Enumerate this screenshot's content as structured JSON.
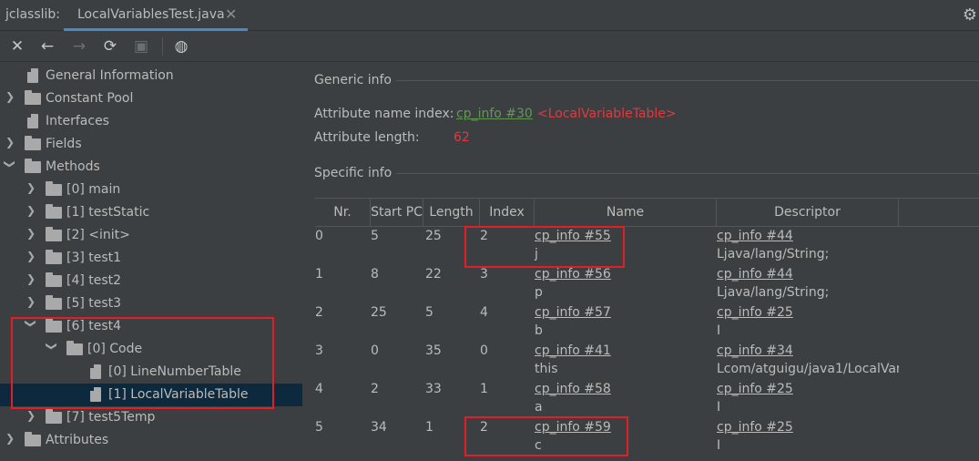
{
  "tabbar": {
    "prefix": "jclasslib:",
    "tab_title": "LocalVariablesTest.java",
    "close_glyph": "✕",
    "gear_glyph": "⚙"
  },
  "toolbar": {
    "close_icon": "✕",
    "back_icon": "←",
    "forward_icon": "→",
    "refresh_icon": "⟳",
    "save_icon": "▣",
    "browser_icon": "◍"
  },
  "tree": {
    "items": [
      {
        "label": "General Information"
      },
      {
        "label": "Constant Pool"
      },
      {
        "label": "Interfaces"
      },
      {
        "label": "Fields"
      },
      {
        "label": "Methods"
      },
      {
        "label": "[0] main"
      },
      {
        "label": "[1] testStatic"
      },
      {
        "label": "[2] <init>"
      },
      {
        "label": "[3] test1"
      },
      {
        "label": "[4] test2"
      },
      {
        "label": "[5] test3"
      },
      {
        "label": "[6] test4"
      },
      {
        "label": "[0] Code"
      },
      {
        "label": "[0] LineNumberTable"
      },
      {
        "label": "[1] LocalVariableTable"
      },
      {
        "label": "[7] test5Temp"
      },
      {
        "label": "Attributes"
      }
    ]
  },
  "generic": {
    "title": "Generic info",
    "name_index_label": "Attribute name index:",
    "name_index_link": "cp_info #30",
    "name_index_value": "<LocalVariableTable>",
    "length_label": "Attribute length:",
    "length_value": "62"
  },
  "specific": {
    "title": "Specific info"
  },
  "table": {
    "headers": [
      "Nr.",
      "Start PC",
      "Length",
      "Index",
      "Name",
      "Descriptor"
    ],
    "rows": [
      {
        "nr": "0",
        "start": "5",
        "length": "25",
        "index": "2",
        "name_link": "cp_info #55",
        "name": "j",
        "desc_link": "cp_info #44",
        "desc": "Ljava/lang/String;"
      },
      {
        "nr": "1",
        "start": "8",
        "length": "22",
        "index": "3",
        "name_link": "cp_info #56",
        "name": "p",
        "desc_link": "cp_info #44",
        "desc": "Ljava/lang/String;"
      },
      {
        "nr": "2",
        "start": "25",
        "length": "5",
        "index": "4",
        "name_link": "cp_info #57",
        "name": "b",
        "desc_link": "cp_info #25",
        "desc": "I"
      },
      {
        "nr": "3",
        "start": "0",
        "length": "35",
        "index": "0",
        "name_link": "cp_info #41",
        "name": "this",
        "desc_link": "cp_info #34",
        "desc": "Lcom/atguigu/java1/LocalVar"
      },
      {
        "nr": "4",
        "start": "2",
        "length": "33",
        "index": "1",
        "name_link": "cp_info #58",
        "name": "a",
        "desc_link": "cp_info #25",
        "desc": "I"
      },
      {
        "nr": "5",
        "start": "34",
        "length": "1",
        "index": "2",
        "name_link": "cp_info #59",
        "name": "c",
        "desc_link": "cp_info #25",
        "desc": "I"
      }
    ]
  },
  "colors": {
    "background": "#3c3f41",
    "selection": "#0d293e",
    "link_green": "#629755",
    "error_red": "#e2383d",
    "annotation_red": "#e31e24",
    "tab_underline": "#4a88c7"
  }
}
